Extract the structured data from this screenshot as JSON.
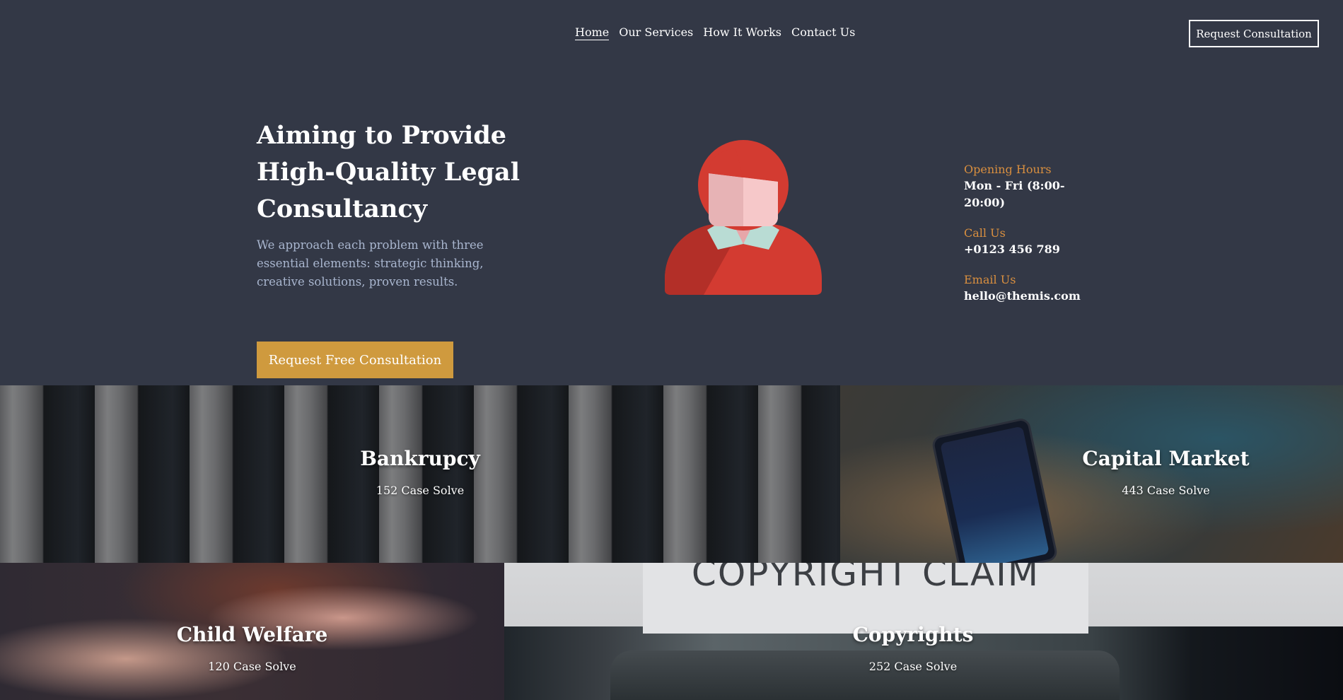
{
  "nav": {
    "links": [
      {
        "label": "Home",
        "active": true
      },
      {
        "label": "Our Services",
        "active": false
      },
      {
        "label": "How It Works",
        "active": false
      },
      {
        "label": "Contact Us",
        "active": false
      }
    ],
    "cta_label": "Request Consultation"
  },
  "hero": {
    "title": "Aiming to Provide High-Quality Legal Consultancy",
    "subtitle": "We approach each problem with three essential elements: strategic thinking, creative solutions, proven results.",
    "button_label": "Request Free Consultation",
    "avatar_icon": "user-avatar-icon"
  },
  "info": {
    "hours_label": "Opening Hours",
    "hours_value": "Mon - Fri (8:00-20:00)",
    "call_label": "Call Us",
    "call_value": "+0123 456 789",
    "email_label": "Email Us",
    "email_value": "hello@themis.com"
  },
  "services": [
    {
      "title": "Bankrupcy",
      "count": "152 Case Solve"
    },
    {
      "title": "Capital Market",
      "count": "443 Case Solve"
    },
    {
      "title": "Child Welfare",
      "count": "120 Case Solve"
    },
    {
      "title": "Copyrights",
      "count": "252 Case Solve",
      "image_text": "COPYRIGHT CLAIM"
    }
  ],
  "colors": {
    "background": "#333846",
    "accent": "#cf9a3e",
    "label": "#d98f3f",
    "subtitle": "#a9b6cf"
  }
}
